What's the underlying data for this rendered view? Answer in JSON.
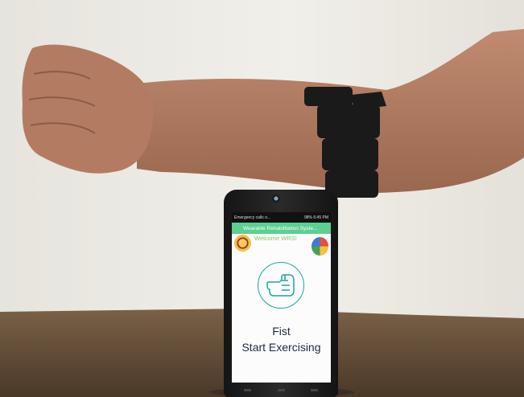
{
  "scene": {
    "wall_color": "#eeece6",
    "table_color": "#5b4633",
    "skin_color": "#b47f66",
    "armband_color": "#1a1a1a"
  },
  "phone": {
    "status_bar": {
      "left_text": "Emergency calls o...",
      "right_text": "98% 6:45 PM"
    },
    "app_title": "Wearable Rehabilitation Syste...",
    "welcome_text": "Welcome WRS!",
    "gesture_icon": "fist-icon",
    "gesture_label": "Fist",
    "action_text": "Start Exercising",
    "accent_color": "#5ccf91"
  }
}
